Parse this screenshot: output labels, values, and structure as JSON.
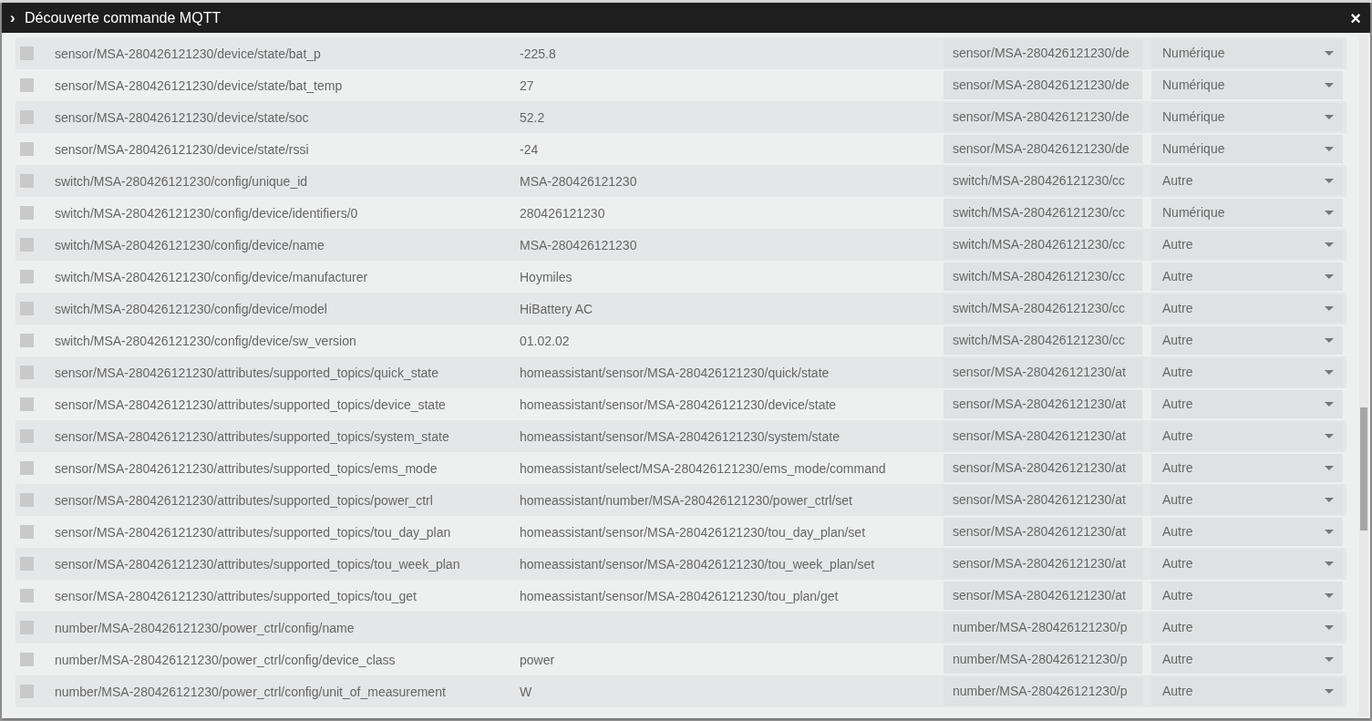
{
  "dialog": {
    "title": "Découverte commande MQTT",
    "close": "×",
    "expand": "›"
  },
  "rows": [
    {
      "checked": false,
      "topic": "sensor/MSA-280426121230/device/state/bat_p",
      "value": "-225.8",
      "name": "sensor/MSA-280426121230/de",
      "type": "Numérique"
    },
    {
      "checked": false,
      "topic": "sensor/MSA-280426121230/device/state/bat_temp",
      "value": "27",
      "name": "sensor/MSA-280426121230/de",
      "type": "Numérique"
    },
    {
      "checked": false,
      "topic": "sensor/MSA-280426121230/device/state/soc",
      "value": "52.2",
      "name": "sensor/MSA-280426121230/de",
      "type": "Numérique"
    },
    {
      "checked": false,
      "topic": "sensor/MSA-280426121230/device/state/rssi",
      "value": "-24",
      "name": "sensor/MSA-280426121230/de",
      "type": "Numérique"
    },
    {
      "checked": false,
      "topic": "switch/MSA-280426121230/config/unique_id",
      "value": "MSA-280426121230",
      "name": "switch/MSA-280426121230/cc",
      "type": "Autre"
    },
    {
      "checked": false,
      "topic": "switch/MSA-280426121230/config/device/identifiers/0",
      "value": "280426121230",
      "name": "switch/MSA-280426121230/cc",
      "type": "Numérique"
    },
    {
      "checked": false,
      "topic": "switch/MSA-280426121230/config/device/name",
      "value": "MSA-280426121230",
      "name": "switch/MSA-280426121230/cc",
      "type": "Autre"
    },
    {
      "checked": false,
      "topic": "switch/MSA-280426121230/config/device/manufacturer",
      "value": "Hoymiles",
      "name": "switch/MSA-280426121230/cc",
      "type": "Autre"
    },
    {
      "checked": false,
      "topic": "switch/MSA-280426121230/config/device/model",
      "value": "HiBattery AC",
      "name": "switch/MSA-280426121230/cc",
      "type": "Autre"
    },
    {
      "checked": false,
      "topic": "switch/MSA-280426121230/config/device/sw_version",
      "value": "01.02.02",
      "name": "switch/MSA-280426121230/cc",
      "type": "Autre"
    },
    {
      "checked": false,
      "topic": "sensor/MSA-280426121230/attributes/supported_topics/quick_state",
      "value": "homeassistant/sensor/MSA-280426121230/quick/state",
      "name": "sensor/MSA-280426121230/at",
      "type": "Autre"
    },
    {
      "checked": false,
      "topic": "sensor/MSA-280426121230/attributes/supported_topics/device_state",
      "value": "homeassistant/sensor/MSA-280426121230/device/state",
      "name": "sensor/MSA-280426121230/at",
      "type": "Autre"
    },
    {
      "checked": false,
      "topic": "sensor/MSA-280426121230/attributes/supported_topics/system_state",
      "value": "homeassistant/sensor/MSA-280426121230/system/state",
      "name": "sensor/MSA-280426121230/at",
      "type": "Autre"
    },
    {
      "checked": false,
      "topic": "sensor/MSA-280426121230/attributes/supported_topics/ems_mode",
      "value": "homeassistant/select/MSA-280426121230/ems_mode/command",
      "name": "sensor/MSA-280426121230/at",
      "type": "Autre"
    },
    {
      "checked": false,
      "topic": "sensor/MSA-280426121230/attributes/supported_topics/power_ctrl",
      "value": "homeassistant/number/MSA-280426121230/power_ctrl/set",
      "name": "sensor/MSA-280426121230/at",
      "type": "Autre"
    },
    {
      "checked": false,
      "topic": "sensor/MSA-280426121230/attributes/supported_topics/tou_day_plan",
      "value": "homeassistant/sensor/MSA-280426121230/tou_day_plan/set",
      "name": "sensor/MSA-280426121230/at",
      "type": "Autre"
    },
    {
      "checked": false,
      "topic": "sensor/MSA-280426121230/attributes/supported_topics/tou_week_plan",
      "value": "homeassistant/sensor/MSA-280426121230/tou_week_plan/set",
      "name": "sensor/MSA-280426121230/at",
      "type": "Autre"
    },
    {
      "checked": false,
      "topic": "sensor/MSA-280426121230/attributes/supported_topics/tou_get",
      "value": "homeassistant/sensor/MSA-280426121230/tou_plan/get",
      "name": "sensor/MSA-280426121230/at",
      "type": "Autre"
    },
    {
      "checked": false,
      "topic": "number/MSA-280426121230/power_ctrl/config/name",
      "name": "number/MSA-280426121230/p",
      "type": "Autre"
    },
    {
      "checked": false,
      "topic": "number/MSA-280426121230/power_ctrl/config/device_class",
      "value": "power",
      "name": "number/MSA-280426121230/p",
      "type": "Autre"
    },
    {
      "checked": false,
      "topic": "number/MSA-280426121230/power_ctrl/config/unit_of_measurement",
      "value": "W",
      "name": "number/MSA-280426121230/p",
      "type": "Autre"
    }
  ]
}
